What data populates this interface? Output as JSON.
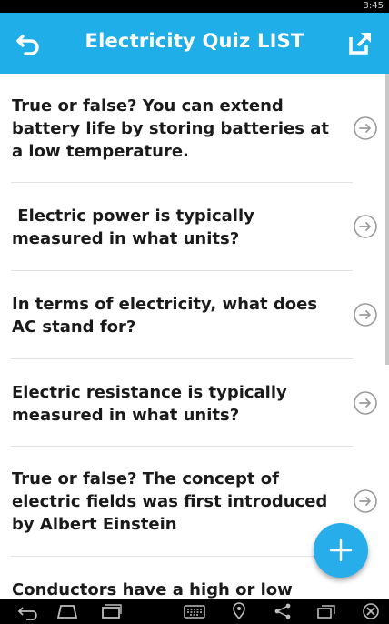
{
  "status_bar": {
    "time": "3:45"
  },
  "app_bar": {
    "title": "Electricity Quiz LIST",
    "back_icon": "back-icon",
    "share_icon": "open-external-icon",
    "color": "#1faee8"
  },
  "questions": [
    {
      "text": "True or false? You can extend battery life by storing batteries at a low temperature."
    },
    {
      "text": " Electric power is typically measured in what units?"
    },
    {
      "text": "In terms of electricity, what does AC stand for?"
    },
    {
      "text": "Electric resistance is typically measured in what units?"
    },
    {
      "text": "True or false? The concept of electric fields was first introduced by Albert Einstein"
    },
    {
      "text": "Conductors have a high or low"
    }
  ],
  "fab": {
    "icon": "plus-icon",
    "color": "#27aeea"
  },
  "nav_bar": {
    "icons": [
      "back-nav-icon",
      "home-nav-icon",
      "recent-apps-icon",
      "keyboard-icon",
      "location-icon",
      "share-nav-icon",
      "window-icon",
      "close-circle-icon"
    ]
  }
}
